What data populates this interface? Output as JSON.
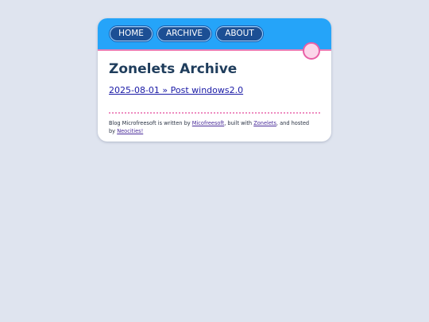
{
  "nav": {
    "home_label": "HOME",
    "archive_label": "ARCHIVE",
    "about_label": "ABOUT"
  },
  "page": {
    "title": "Zonelets Archive"
  },
  "posts": [
    {
      "label": "2025-08-01 » Post windows2.0"
    }
  ],
  "footer": {
    "text_1": "Blog Microfreesoft is written by ",
    "author_link": "Micofreesoft",
    "text_2": ", built with ",
    "zonelets_link": "Zonelets",
    "text_3": ", and hosted by ",
    "neocities_link": "Neocities!"
  },
  "colors": {
    "page_background": "#dfe4ef",
    "header_blue": "#25a4f9",
    "nav_button": "#1c4f94",
    "accent_pink": "#e85fa6",
    "title": "#1f3d5c",
    "link": "#1a1aa6"
  }
}
